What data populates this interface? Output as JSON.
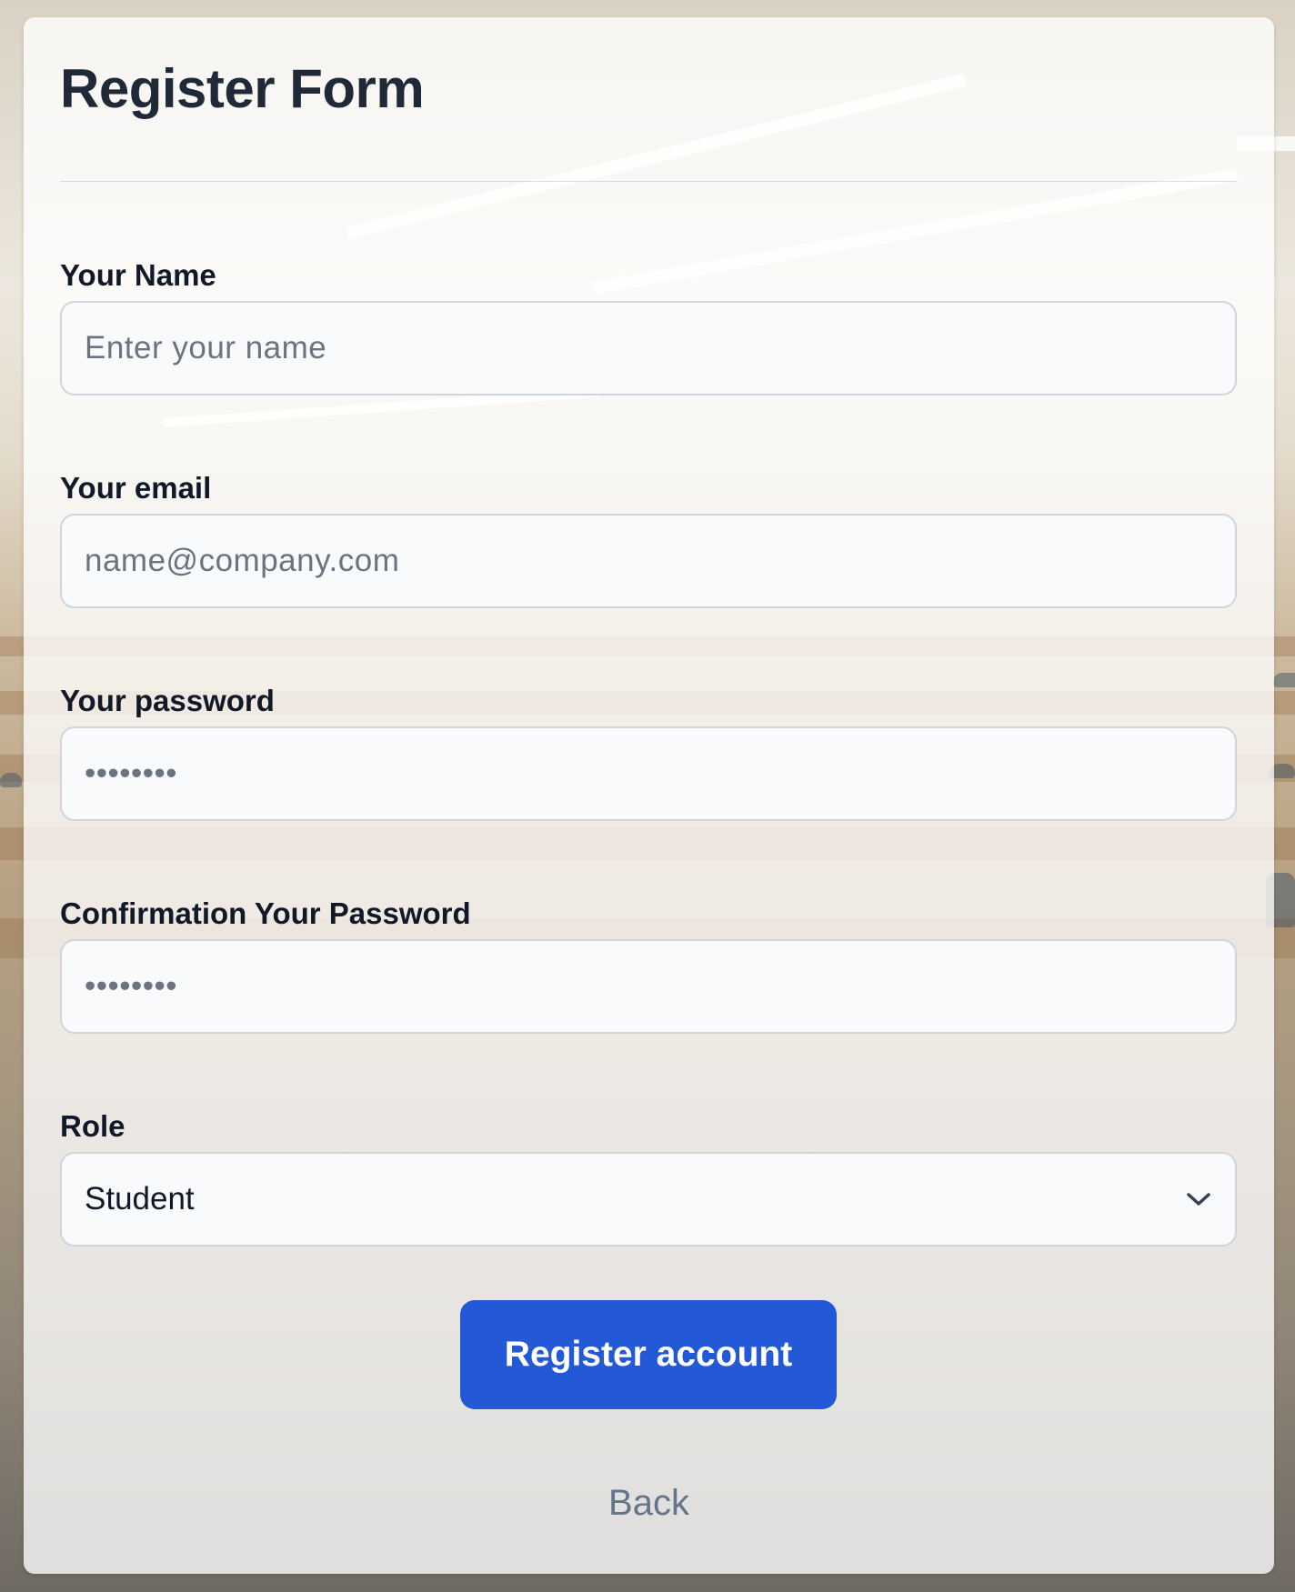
{
  "form": {
    "title": "Register Form",
    "fields": [
      {
        "label": "Your Name",
        "placeholder": "Enter your name",
        "value": ""
      },
      {
        "label": "Your email",
        "placeholder": "name@company.com",
        "value": ""
      },
      {
        "label": "Your password",
        "placeholder": "••••••••",
        "value": ""
      },
      {
        "label": "Confirmation Your Password",
        "placeholder": "••••••••",
        "value": ""
      }
    ],
    "role": {
      "label": "Role",
      "selected": "Student",
      "icon": "chevron-down-icon"
    },
    "submit_label": "Register account",
    "back_label": "Back"
  },
  "colors": {
    "primary": "#2358d6",
    "title": "#1f2937",
    "label": "#111827",
    "placeholder": "#6b7280",
    "back_link": "#64748b",
    "input_bg": "#f9fafb",
    "input_border": "#d1d5db"
  }
}
